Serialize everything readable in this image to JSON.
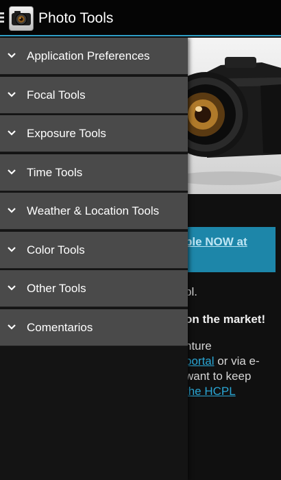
{
  "action_bar": {
    "title": "Photo Tools",
    "app_icon": "camera-app-icon",
    "drawer_indicator_icon": "menu-icon"
  },
  "drawer": {
    "items": [
      {
        "label": "Application Preferences",
        "icon": "chevron-down-icon"
      },
      {
        "label": "Focal Tools",
        "icon": "chevron-down-icon"
      },
      {
        "label": "Exposure Tools",
        "icon": "chevron-down-icon"
      },
      {
        "label": "Time Tools",
        "icon": "chevron-down-icon"
      },
      {
        "label": "Weather & Location Tools",
        "icon": "chevron-down-icon"
      },
      {
        "label": "Color Tools",
        "icon": "chevron-down-icon"
      },
      {
        "label": "Other Tools",
        "icon": "chevron-down-icon"
      },
      {
        "label": "Comentarios",
        "icon": "chevron-down-icon"
      }
    ]
  },
  "content": {
    "promo_link": "ble NOW at",
    "line_1": "pl.",
    "line_2": "on the market!",
    "line_3": "nture",
    "line_4_link": "portal",
    "line_4_rest": " or via e-",
    "line_5": "want to keep",
    "line_6_link": "the HCPL"
  },
  "colors": {
    "accent": "#2f9fc6",
    "drawer_item_bg": "#4a4a4a",
    "promo_bg": "#1d86a9",
    "link": "#2aa7d6"
  }
}
